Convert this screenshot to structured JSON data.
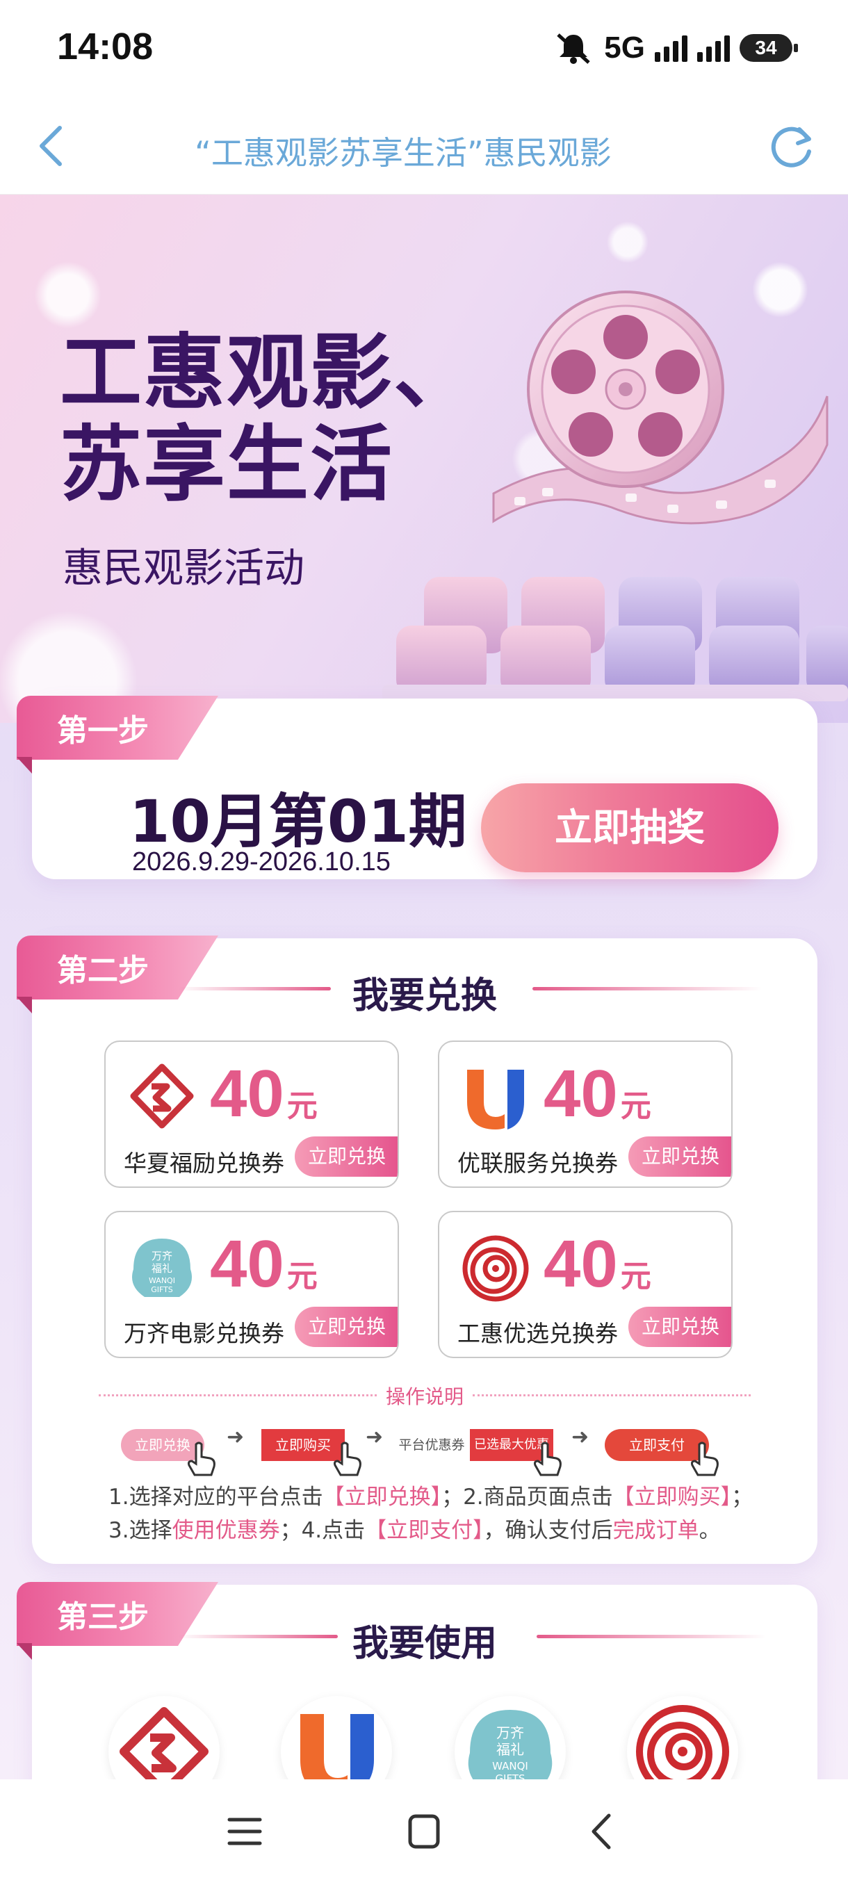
{
  "status_bar": {
    "time": "14:08",
    "network": "5G",
    "battery": "34"
  },
  "header": {
    "title": "“工惠观影苏享生活”惠民观影",
    "back_icon": "chevron-left-icon",
    "refresh_icon": "refresh-icon"
  },
  "hero": {
    "title_line1": "工惠观影、",
    "title_line2": "苏享生活",
    "subtitle": "惠民观影活动"
  },
  "step1": {
    "tag": "第一步",
    "period": "10月第01期",
    "dates": "2026.9.29-2026.10.15",
    "draw_button": "立即抽奖"
  },
  "step2": {
    "tag": "第二步",
    "title": "我要兑换",
    "vouchers": [
      {
        "amount": "40",
        "unit": "元",
        "name": "华夏福励兑换券",
        "button": "立即兑换",
        "logo": "huaxia-logo-icon"
      },
      {
        "amount": "40",
        "unit": "元",
        "name": "优联服务兑换券",
        "button": "立即兑换",
        "logo": "youlian-u-logo-icon"
      },
      {
        "amount": "40",
        "unit": "元",
        "name": "万齐电影兑换券",
        "button": "立即兑换",
        "logo": "wanqi-gifts-logo-icon"
      },
      {
        "amount": "40",
        "unit": "元",
        "name": "工惠优选兑换券",
        "button": "立即兑换",
        "logo": "gonghui-spiral-logo-icon"
      }
    ],
    "instructions": {
      "heading": "操作说明",
      "flow": [
        "立即兑换",
        "立即购买",
        "平台优惠券",
        "已选最大优惠",
        "立即支付"
      ],
      "line1_a": "1.选择对应的平台点击",
      "line1_b": "【立即兑换】",
      "line1_c": "；2.商品页面点击",
      "line1_d": "【立即购买】",
      "line1_e": "；",
      "line2_a": "3.选择",
      "line2_b": "使用优惠券",
      "line2_c": "；4.点击",
      "line2_d": "【立即支付】",
      "line2_e": "，确认支付后",
      "line2_f": "完成订单",
      "line2_g": "。"
    }
  },
  "step3": {
    "tag": "第三步",
    "title": "我要使用"
  },
  "logo_text": {
    "wanqi_1": "万齐",
    "wanqi_2": "福礼",
    "wanqi_3": "WANQI",
    "wanqi_4": "GIFTS"
  },
  "colors": {
    "accent_pink": "#e35a89",
    "title_blue": "#6aa8d8",
    "deep_purple": "#3a1563"
  },
  "bottom_nav": [
    "menu-icon",
    "home-square-icon",
    "back-icon"
  ]
}
